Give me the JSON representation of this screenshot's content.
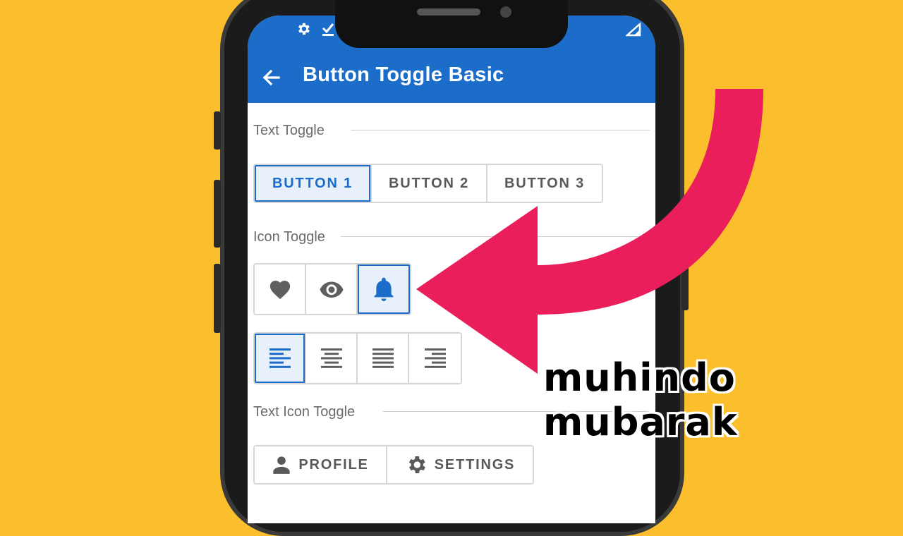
{
  "app": {
    "title": "Button Toggle Basic"
  },
  "status_bar": {
    "icons": [
      "gear-icon",
      "check-download-icon",
      "signal-icon"
    ]
  },
  "sections": {
    "text_toggle": {
      "label": "Text Toggle",
      "buttons": [
        "BUTTON 1",
        "BUTTON 2",
        "BUTTON 3"
      ],
      "selected_index": 0
    },
    "icon_toggle": {
      "label": "Icon Toggle",
      "row1_icons": [
        "heart-icon",
        "eye-icon",
        "bell-icon"
      ],
      "row1_selected_index": 2,
      "row2_icons": [
        "align-left-icon",
        "align-center-icon",
        "align-justify-icon",
        "align-right-icon"
      ],
      "row2_selected_index": 0
    },
    "text_icon_toggle": {
      "label": "Text Icon Toggle",
      "buttons": [
        {
          "icon": "person-icon",
          "label": "PROFILE"
        },
        {
          "icon": "gear-icon",
          "label": "SETTINGS"
        }
      ]
    }
  },
  "overlay": {
    "watermark": "muhindo mubarak",
    "arrow_color": "#e91e5a"
  },
  "colors": {
    "background": "#fbbf2d",
    "accent": "#1c6dc9",
    "selected_fill": "#e8f1fb"
  }
}
